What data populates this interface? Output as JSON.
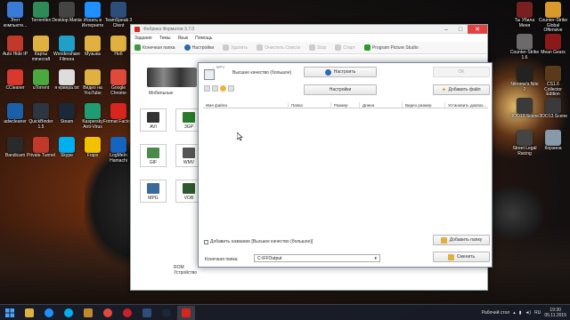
{
  "desktop_left": [
    {
      "label": "Этот компьюте...",
      "icon": "computer-icon",
      "color": "#3a7bd5"
    },
    {
      "label": "Torrentlex",
      "icon": "torrent-icon",
      "color": "#2e8b57"
    },
    {
      "label": "Desktop Mania",
      "icon": "desktop-mania-icon",
      "color": "#444444"
    },
    {
      "label": "Искать в Интернете",
      "icon": "search-icon",
      "color": "#1e90ff"
    },
    {
      "label": "TeamSpeak 3 Client",
      "icon": "teamspeak-icon",
      "color": "#2b4f7a"
    },
    {
      "label": "Auto Hide IP",
      "icon": "autohideip-icon",
      "color": "#c0392b"
    },
    {
      "label": "Карты minecraft",
      "icon": "folder-icon",
      "color": "#e0b040"
    },
    {
      "label": "Wondershare Filmora",
      "icon": "filmora-icon",
      "color": "#1fa0c8"
    },
    {
      "label": "Музыка",
      "icon": "folder-icon",
      "color": "#e0b040"
    },
    {
      "label": "Ноб",
      "icon": "folder-icon",
      "color": "#e0b040"
    },
    {
      "label": "CCleaner",
      "icon": "ccleaner-icon",
      "color": "#d9382c"
    },
    {
      "label": "uTorrent",
      "icon": "utorrent-icon",
      "color": "#4aa83c"
    },
    {
      "label": "я ервера.txt",
      "icon": "text-file-icon",
      "color": "#dddddd"
    },
    {
      "label": "Видео на YouTube",
      "icon": "folder-icon",
      "color": "#e0b040"
    },
    {
      "label": "Google Chrome",
      "icon": "chrome-icon",
      "color": "#e04a3a"
    },
    {
      "label": "adwcleaner",
      "icon": "adwcleaner-icon",
      "color": "#1b5fa8"
    },
    {
      "label": "QuickBinder 1.5",
      "icon": "quickbinder-icon",
      "color": "#2d3540"
    },
    {
      "label": "Steam",
      "icon": "steam-icon",
      "color": "#1b2838"
    },
    {
      "label": "Kaspersky Anti-Virus",
      "icon": "kaspersky-icon",
      "color": "#1f9c72"
    },
    {
      "label": "Format Factory",
      "icon": "format-factory-icon",
      "color": "#d7261e"
    },
    {
      "label": "Bandicam",
      "icon": "bandicam-icon",
      "color": "#2a2a2a"
    },
    {
      "label": "Private Tunnel",
      "icon": "private-tunnel-icon",
      "color": "#c0392b"
    },
    {
      "label": "Skype",
      "icon": "skype-icon",
      "color": "#00aff0"
    },
    {
      "label": "Fraps",
      "icon": "fraps-icon",
      "color": "#f2c200"
    },
    {
      "label": "LogMeIn Hamachi",
      "icon": "hamachi-icon",
      "color": "#1565c0"
    }
  ],
  "desktop_right": [
    {
      "label": "Ты Убила Меня",
      "icon": "game-icon",
      "color": "#7a1f1f"
    },
    {
      "label": "Counter-Strike Global Offensive",
      "icon": "csgo-icon",
      "color": "#d99a2b"
    },
    {
      "label": "Counter-Strike 1.6",
      "icon": "cs-icon",
      "color": "#6b6b6b"
    },
    {
      "label": "Mean Gears",
      "icon": "game-icon",
      "color": "#8a1a1a"
    },
    {
      "label": "Nitrome's Nite 2",
      "icon": "game-icon",
      "color": "#222222"
    },
    {
      "label": "CS1.6 Collector Edition",
      "icon": "cs-icon",
      "color": "#5a3a1a"
    },
    {
      "label": "ЗОО13 Scene",
      "icon": "game-icon",
      "color": "#3a3a3a"
    },
    {
      "label": "ЗОО13 Scene",
      "icon": "game-icon",
      "color": "#3a3a3a"
    },
    {
      "label": "Street Legal Racing",
      "icon": "game-icon",
      "color": "#444444"
    },
    {
      "label": "Корзина",
      "icon": "recycle-bin-icon",
      "color": "#8899aa"
    }
  ],
  "bg_window": {
    "title": "Фабрика Форматов 3.7.0",
    "menu": [
      "Задание",
      "Темы",
      "Язык",
      "Помощь"
    ],
    "toolbar": [
      "Конечная папка",
      "Настройки",
      "Удалить",
      "Очистить Список",
      "Stop",
      "Старт",
      "Program Picture Studio"
    ],
    "category": "Мобильные",
    "formats": [
      "AVI",
      "3GP",
      "GIF",
      "WMV",
      "MPG",
      "VOB"
    ],
    "status": "ROM Устройство"
  },
  "dialog": {
    "title": "→ MP4",
    "quality_label": "Высшее качество (большое)",
    "settings_button": "Настроить",
    "settings_button2": "Настройки",
    "ok_button": "OK",
    "add_file_button": "Добавить файл",
    "columns": [
      "Имя файла",
      "Папка",
      "Размер",
      "Длина",
      "Видео размер",
      "Установить диапаз..."
    ],
    "add_name_checkbox": "Добавить название [Высшее качество (большое)]",
    "output_label": "Конечная папка",
    "output_value": "C:\\FFOutput",
    "add_folder_button": "Добавить папку",
    "change_button": "Сменить"
  },
  "taskbar": {
    "lang": "RU",
    "tray_text": "Рабочий стол",
    "time": "19:30",
    "date": "05.11.2015"
  }
}
